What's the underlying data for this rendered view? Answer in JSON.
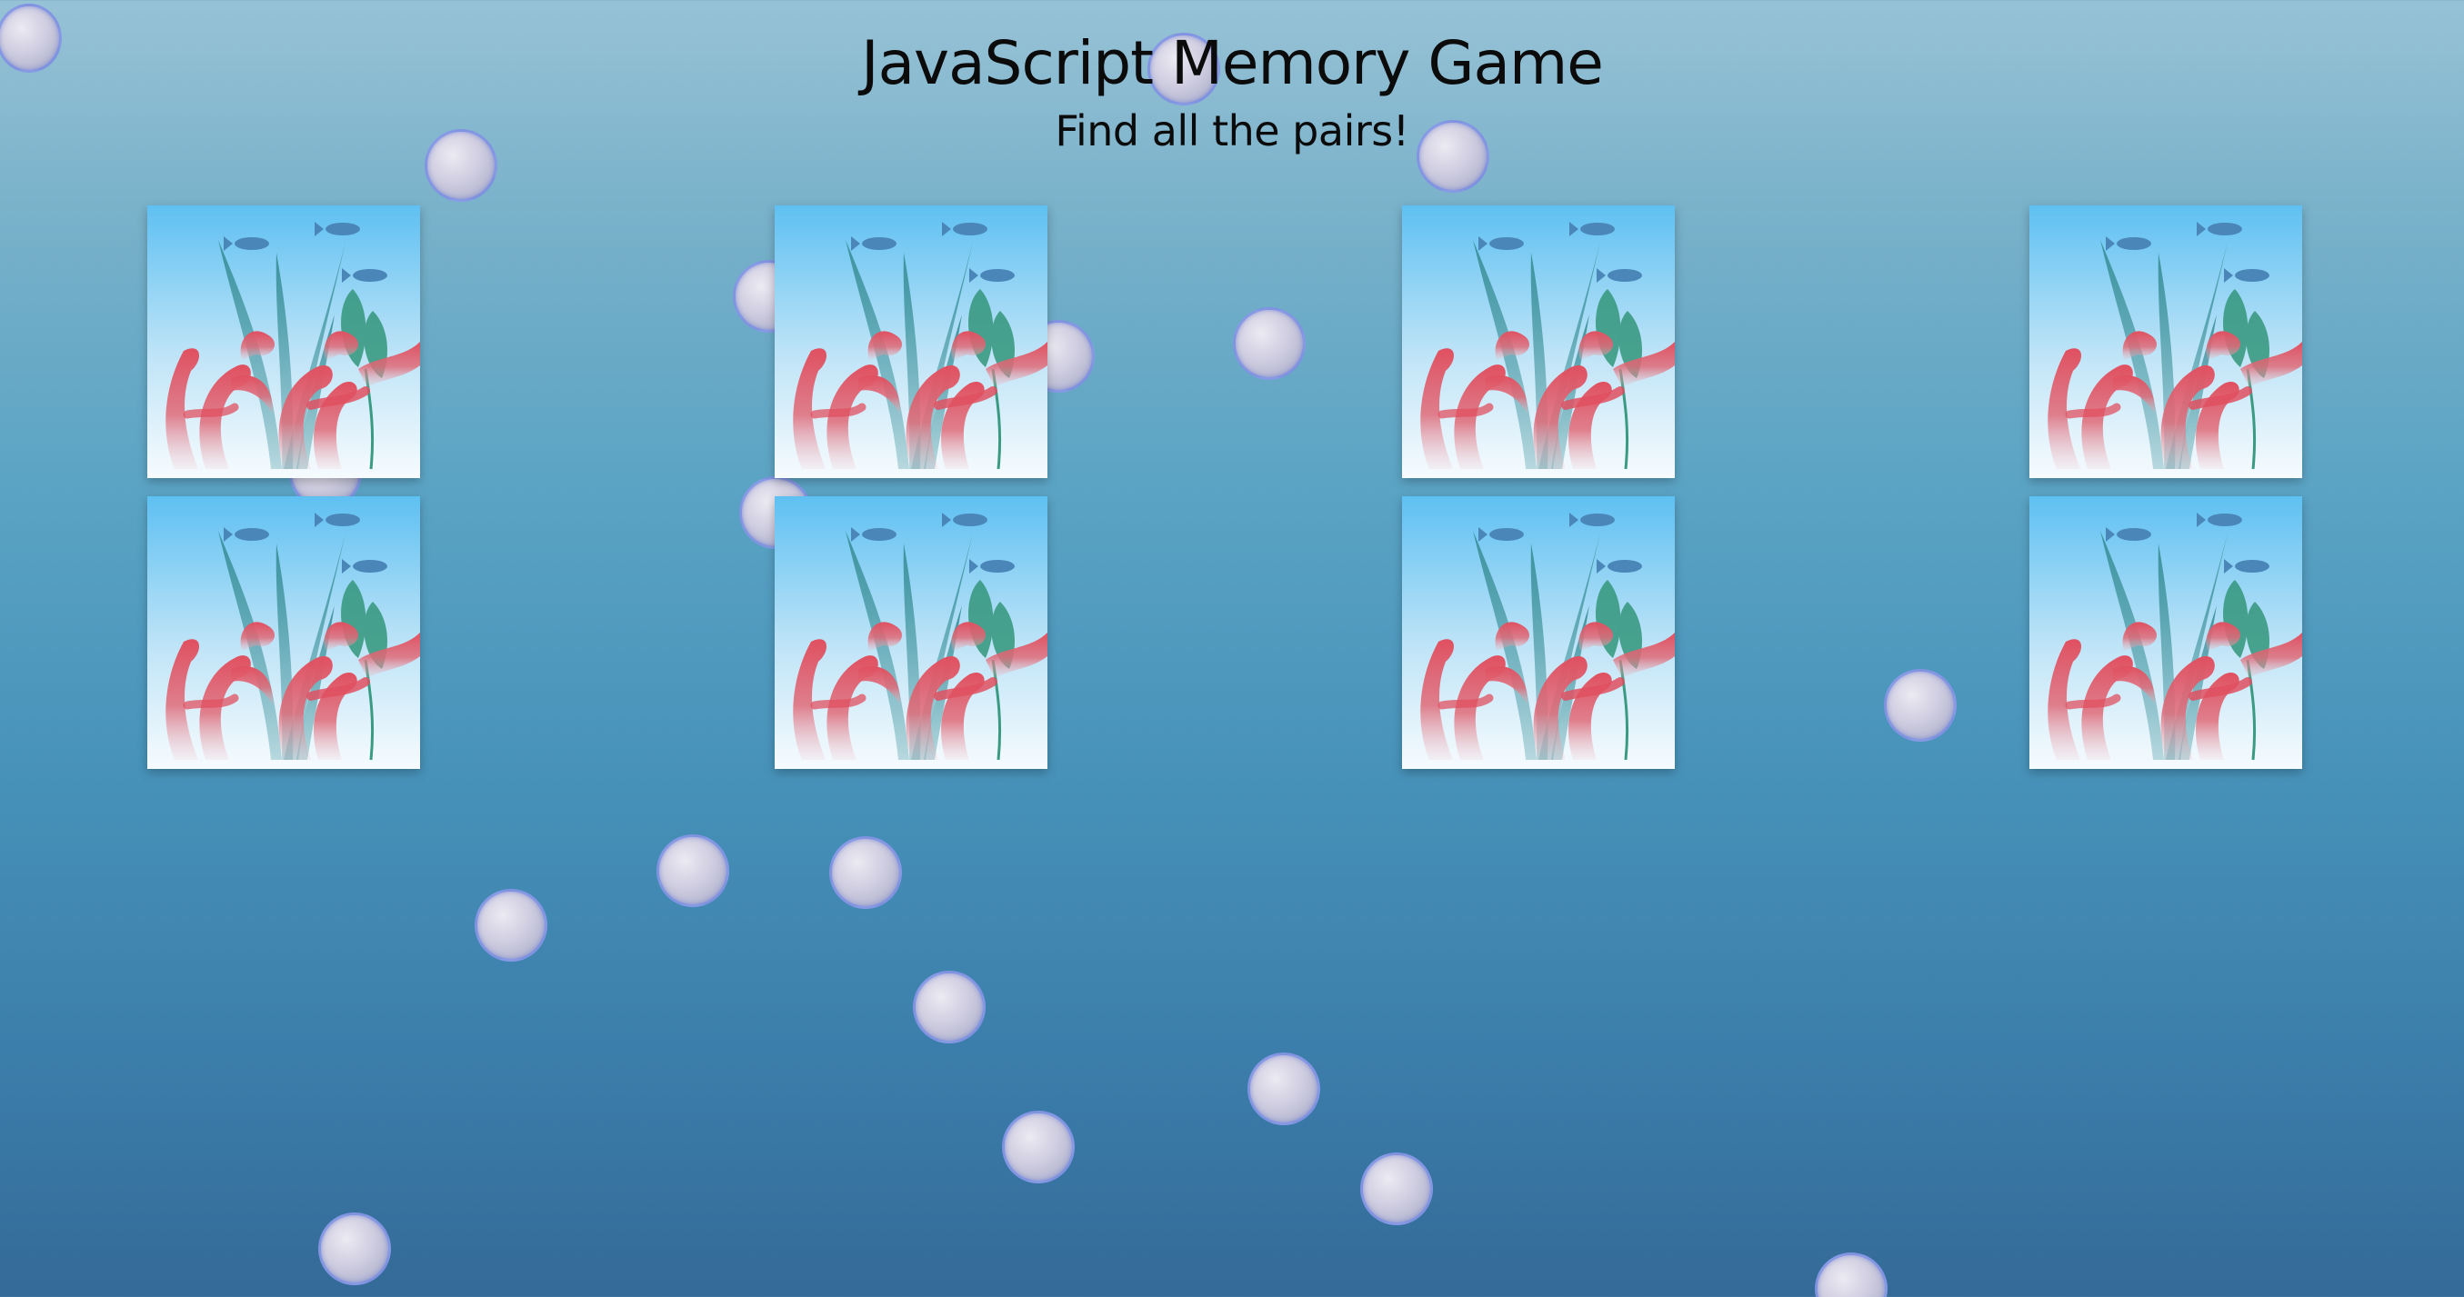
{
  "header": {
    "title": "JavaScript Memory Game",
    "subtitle": "Find all the pairs!"
  },
  "board": {
    "rows": 2,
    "columns": 4,
    "cards": [
      {
        "state": "face-down",
        "icon": "coral-reef-card-back-icon"
      },
      {
        "state": "face-down",
        "icon": "coral-reef-card-back-icon"
      },
      {
        "state": "face-down",
        "icon": "coral-reef-card-back-icon"
      },
      {
        "state": "face-down",
        "icon": "coral-reef-card-back-icon"
      },
      {
        "state": "face-down",
        "icon": "coral-reef-card-back-icon"
      },
      {
        "state": "face-down",
        "icon": "coral-reef-card-back-icon"
      },
      {
        "state": "face-down",
        "icon": "coral-reef-card-back-icon"
      },
      {
        "state": "face-down",
        "icon": "coral-reef-card-back-icon"
      }
    ]
  },
  "background": {
    "decoration": "floating-bubbles",
    "colors": {
      "top": "#97c2d6",
      "bottom": "#346a97",
      "bubble": "#cfcde0"
    }
  }
}
